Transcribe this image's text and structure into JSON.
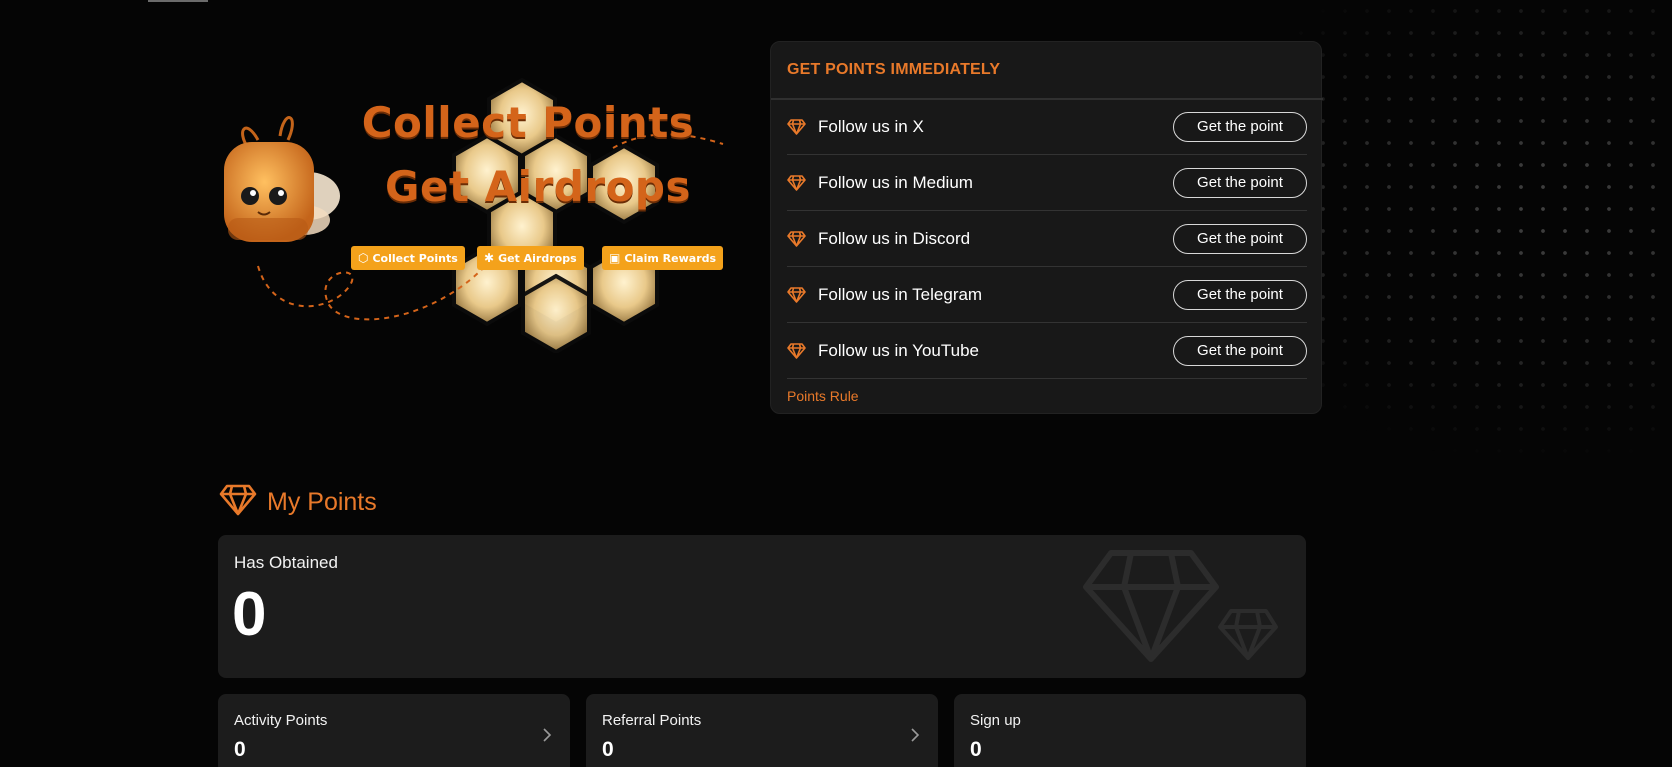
{
  "banner": {
    "title_line1": "Collect Points",
    "title_line2": "Get Airdrops",
    "chips": [
      {
        "label": "Collect Points",
        "icon": "hexagon-icon"
      },
      {
        "label": "Get Airdrops",
        "icon": "bee-icon"
      },
      {
        "label": "Claim Rewards",
        "icon": "gift-icon"
      }
    ]
  },
  "panel": {
    "title": "GET POINTS IMMEDIATELY",
    "tasks": [
      {
        "label": "Follow us in X",
        "button": "Get the point"
      },
      {
        "label": "Follow us in Medium",
        "button": "Get the point"
      },
      {
        "label": "Follow us in Discord",
        "button": "Get the point"
      },
      {
        "label": "Follow us in Telegram",
        "button": "Get the point"
      },
      {
        "label": "Follow us in YouTube",
        "button": "Get the point"
      }
    ],
    "rule_link": "Points Rule"
  },
  "my_points": {
    "title": "My Points",
    "obtained_label": "Has Obtained",
    "obtained_value": "0",
    "cards": [
      {
        "label": "Activity Points",
        "value": "0",
        "has_arrow": true
      },
      {
        "label": "Referral Points",
        "value": "0",
        "has_arrow": true
      },
      {
        "label": "Sign up",
        "value": "0",
        "has_arrow": false
      }
    ]
  },
  "colors": {
    "accent": "#e8792a",
    "background": "#050505",
    "card": "#1c1c1c",
    "chip": "#f4a21b",
    "banner_title": "#d4641a"
  }
}
